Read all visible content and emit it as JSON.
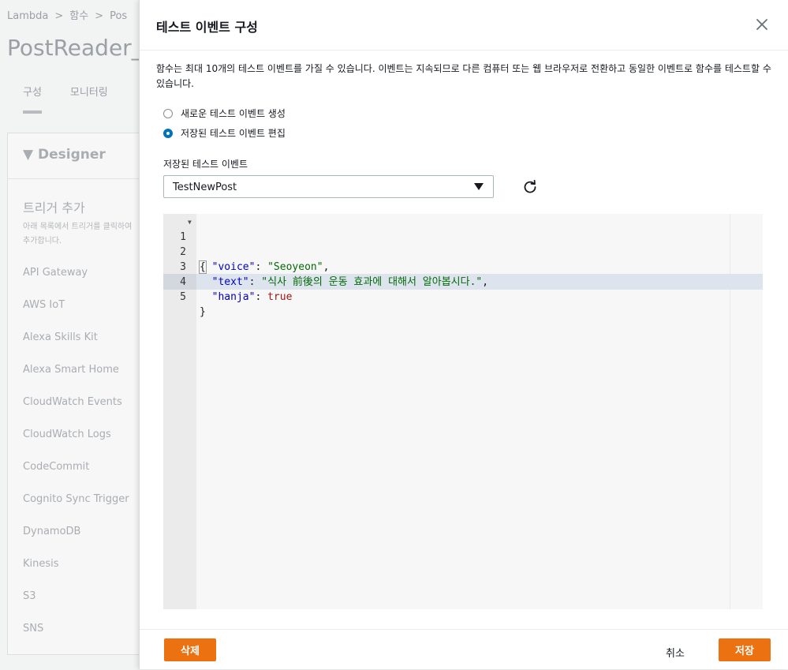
{
  "background": {
    "breadcrumb": [
      "Lambda",
      "함수",
      "Pos"
    ],
    "function_name": "PostReader_N",
    "tabs": [
      "구성",
      "모니터링"
    ],
    "designer_title": "Designer",
    "trigger_title": "트리거 추가",
    "trigger_desc": "아래 목록에서 트리거를 클릭하여 추가합니다.",
    "triggers": [
      "API Gateway",
      "AWS IoT",
      "Alexa Skills Kit",
      "Alexa Smart Home",
      "CloudWatch Events",
      "CloudWatch Logs",
      "CodeCommit",
      "Cognito Sync Trigger",
      "DynamoDB",
      "Kinesis",
      "S3",
      "SNS"
    ]
  },
  "modal": {
    "title": "테스트 이벤트 구성",
    "description": "함수는 최대 10개의 테스트 이벤트를 가질 수 있습니다. 이벤트는 지속되므로 다른 컴퓨터 또는 웹 브라우저로 전환하고 동일한 이벤트로 함수를 테스트할 수 있습니다.",
    "options": [
      {
        "label": "새로운 테스트 이벤트 생성",
        "selected": false
      },
      {
        "label": "저장된 테스트 이벤트 편집",
        "selected": true
      }
    ],
    "saved_events_label": "저장된 테스트 이벤트",
    "selected_event": "TestNewPost",
    "delete_label": "삭제",
    "cancel_label": "취소",
    "save_label": "저장"
  },
  "editor": {
    "line_numbers": [
      "1",
      "2",
      "3",
      "4",
      "5"
    ],
    "lines": [
      {
        "parts": [
          [
            "p",
            "{"
          ]
        ]
      },
      {
        "parts": [
          [
            "p",
            "  "
          ],
          [
            "key",
            "\"voice\""
          ],
          [
            "p",
            ": "
          ],
          [
            "str",
            "\"Seoyeon\""
          ],
          [
            "p",
            ","
          ]
        ]
      },
      {
        "parts": [
          [
            "p",
            "  "
          ],
          [
            "key",
            "\"text\""
          ],
          [
            "p",
            ": "
          ],
          [
            "str",
            "\"식사 前後의 운동 효과에 대해서 알아봅시다.\""
          ],
          [
            "p",
            ","
          ]
        ]
      },
      {
        "parts": [
          [
            "p",
            "  "
          ],
          [
            "key",
            "\"hanja\""
          ],
          [
            "p",
            ": "
          ],
          [
            "bool",
            "true"
          ]
        ]
      },
      {
        "parts": [
          [
            "p",
            "}"
          ]
        ]
      }
    ]
  },
  "colors": {
    "accent": "#ec7211",
    "radio_selected": "#0073bb"
  }
}
